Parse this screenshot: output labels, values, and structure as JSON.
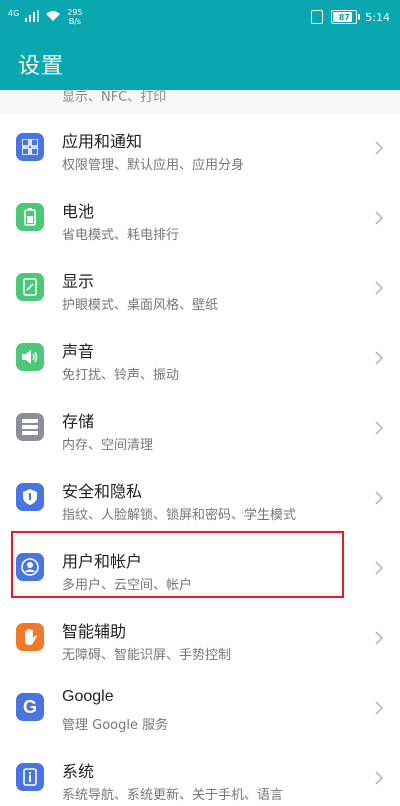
{
  "status_bar": {
    "network": "4G",
    "speed_value": "295",
    "speed_unit": "B/s",
    "battery": "87",
    "battery_level": 0.87,
    "time": "5:14"
  },
  "header": {
    "title": "设置"
  },
  "peek_text": "显示、NFC、打印",
  "items": [
    {
      "label": "应用和通知",
      "sub": "权限管理、默认应用、应用分身",
      "icon": "apps-icon",
      "color": "#4a74e0"
    },
    {
      "label": "电池",
      "sub": "省电模式、耗电排行",
      "icon": "battery-icon",
      "color": "#4cc879"
    },
    {
      "label": "显示",
      "sub": "护眼模式、桌面风格、壁纸",
      "icon": "display-icon",
      "color": "#4cc879"
    },
    {
      "label": "声音",
      "sub": "免打扰、铃声、振动",
      "icon": "sound-icon",
      "color": "#4cc879"
    },
    {
      "label": "存储",
      "sub": "内存、空间清理",
      "icon": "storage-icon",
      "color": "#8a8f99"
    },
    {
      "label": "安全和隐私",
      "sub": "指纹、人脸解锁、锁屏和密码、学生模式",
      "icon": "shield-icon",
      "color": "#4a74e0"
    },
    {
      "label": "用户和帐户",
      "sub": "多用户、云空间、帐户",
      "icon": "user-icon",
      "color": "#4a74e0"
    },
    {
      "label": "智能辅助",
      "sub": "无障碍、智能识屏、手势控制",
      "icon": "hand-icon",
      "color": "#f07a2a"
    },
    {
      "label": "Google",
      "sub": "管理 Google 服务",
      "icon": "google-icon",
      "color": "#4a74e0"
    },
    {
      "label": "系统",
      "sub": "系统导航、系统更新、关于手机、语言",
      "icon": "system-icon",
      "color": "#4a74e0"
    }
  ]
}
